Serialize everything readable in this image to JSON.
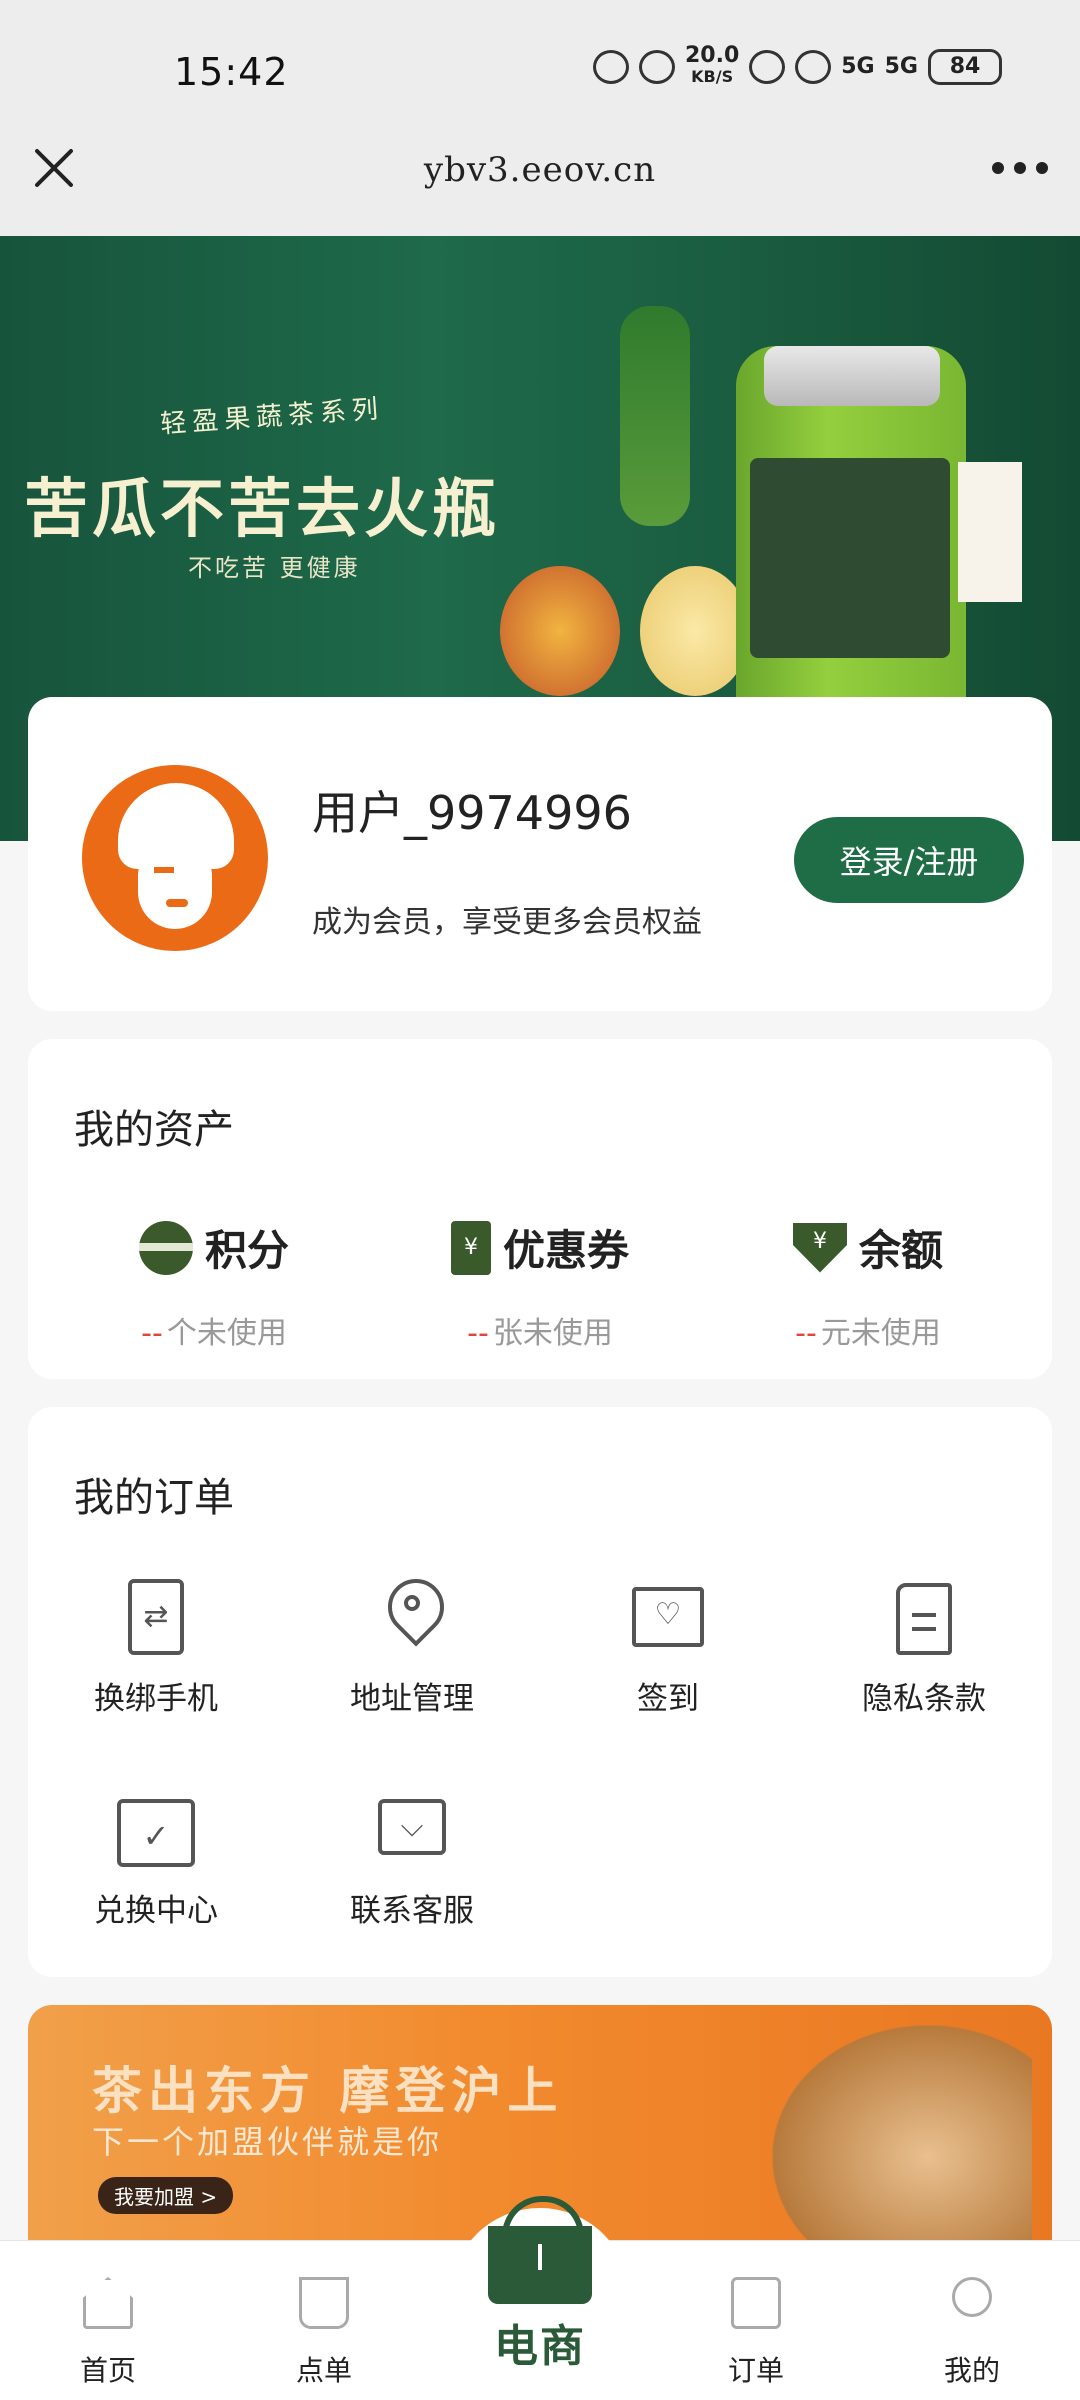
{
  "status_bar": {
    "time": "15:42",
    "net_speed": "20.0",
    "net_unit": "KB/S",
    "signal1": "5G",
    "signal2": "5G",
    "battery": "84"
  },
  "browser": {
    "url": "ybv3.eeov.cn"
  },
  "banner": {
    "series": "轻盈果蔬茶系列",
    "title": "苦瓜不苦去火瓶",
    "subtitle": "不吃苦 更健康"
  },
  "user": {
    "name": "用户_9974996",
    "member_tip": "成为会员，享受更多会员权益",
    "login_label": "登录/注册"
  },
  "assets": {
    "title": "我的资产",
    "items": [
      {
        "label": "积分",
        "value": "--",
        "unit_text": "个未使用",
        "icon": "coins-icon"
      },
      {
        "label": "优惠券",
        "value": "--",
        "unit_text": "张未使用",
        "icon": "coupon-icon"
      },
      {
        "label": "余额",
        "value": "--",
        "unit_text": "元未使用",
        "icon": "wallet-icon"
      }
    ]
  },
  "orders": {
    "title": "我的订单",
    "items": [
      {
        "label": "换绑手机",
        "icon": "phone-swap-icon"
      },
      {
        "label": "地址管理",
        "icon": "location-pin-icon"
      },
      {
        "label": "签到",
        "icon": "chat-heart-icon"
      },
      {
        "label": "隐私条款",
        "icon": "document-icon"
      },
      {
        "label": "兑换中心",
        "icon": "calendar-check-icon"
      },
      {
        "label": "联系客服",
        "icon": "service-chat-icon"
      }
    ]
  },
  "promo": {
    "title": "茶出东方 摩登沪上",
    "subtitle": "下一个加盟伙伴就是你",
    "button": "我要加盟 >"
  },
  "tabbar": {
    "home": "首页",
    "menu": "点单",
    "shop": "电商",
    "orders": "订单",
    "me": "我的"
  },
  "colors": {
    "brand_green": "#1f6d47",
    "avatar_orange": "#ea6a16",
    "dash_red": "#e0443a"
  }
}
